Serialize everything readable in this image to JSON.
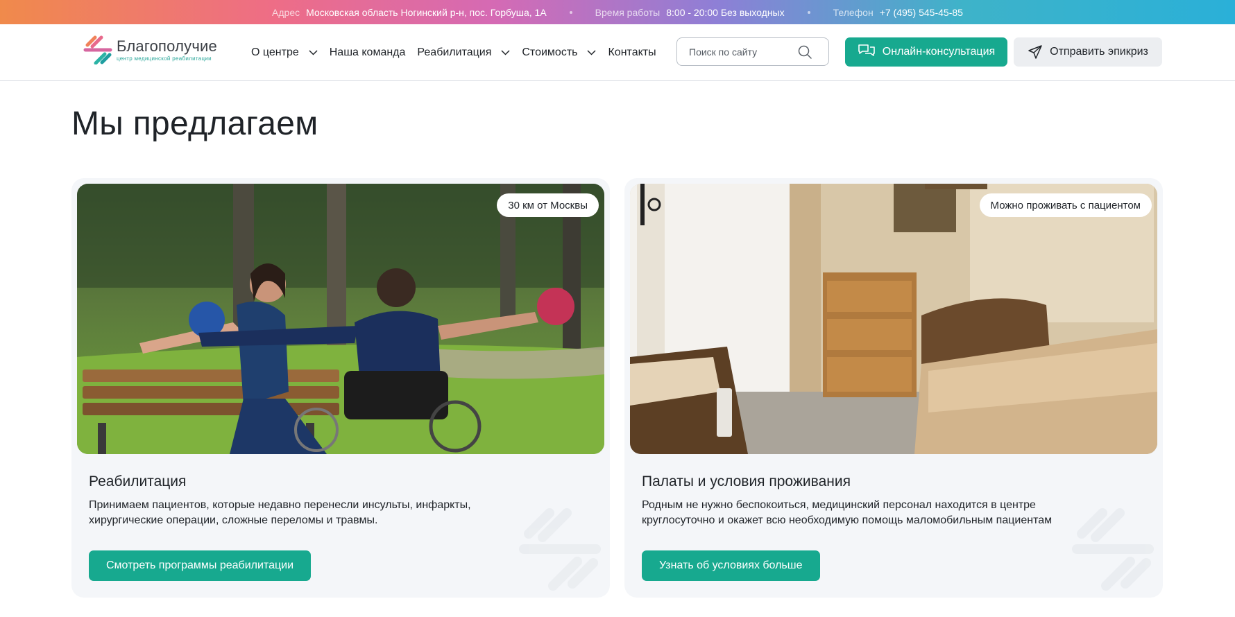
{
  "topbar": {
    "address_label": "Адрес",
    "address_value": "Московская область Ногинский р-н, пос. Горбуша, 1А",
    "hours_label": "Время работы",
    "hours_value": "8:00 - 20:00 Без выходных",
    "phone_label": "Телефон",
    "phone_value": "+7 (495) 545-45-85"
  },
  "logo": {
    "name": "Благополучие",
    "subtitle": "центр медицинской реабилитации"
  },
  "nav": {
    "items": [
      {
        "label": "О центре",
        "has_dropdown": true
      },
      {
        "label": "Наша команда",
        "has_dropdown": false
      },
      {
        "label": "Реабилитация",
        "has_dropdown": true
      },
      {
        "label": "Стоимость",
        "has_dropdown": true
      },
      {
        "label": "Контакты",
        "has_dropdown": false
      }
    ]
  },
  "search": {
    "placeholder": "Поиск по сайту",
    "icon": "search-icon"
  },
  "buttons": {
    "consult_label": "Онлайн-консультация",
    "consult_icon": "chat-icon",
    "send_label": "Отправить эпикриз",
    "send_icon": "paper-plane-icon"
  },
  "page": {
    "title": "Мы предлагаем"
  },
  "cards": [
    {
      "badge": "30 км от Москвы",
      "title": "Реабилитация",
      "text": "Принимаем пациентов, которые недавно перенесли инсульты, инфаркты, хирургические операции, сложные переломы и травмы.",
      "button": "Смотреть программы реабилитации"
    },
    {
      "badge": "Можно проживать с пациентом",
      "title": "Палаты и условия проживания",
      "text": "Родным не нужно беспокоиться, медицинский персонал находится в центре круглосуточно и окажет всю необходимую помощь маломобильным пациентам",
      "button": "Узнать об условиях больше"
    }
  ],
  "colors": {
    "accent": "#17a98f",
    "card_bg": "#f4f6f9",
    "text": "#1f2328"
  }
}
